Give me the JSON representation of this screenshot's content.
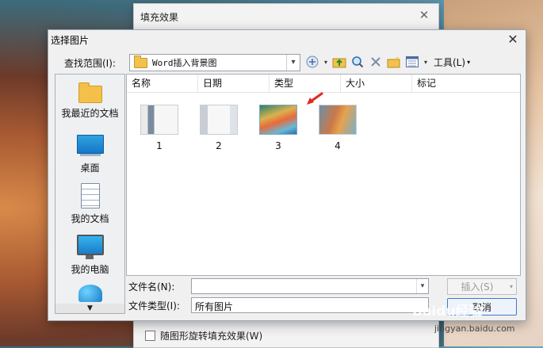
{
  "background_dialog": {
    "title": "填充效果",
    "close_glyph": "✕",
    "checkbox_label": "随图形旋转填充效果(W)"
  },
  "dialog": {
    "title": "选择图片",
    "close_glyph": "✕",
    "lookin_label": "查找范围(I):",
    "lookin_value": "Word插入背景图",
    "tools_label": "工具(L)",
    "sidebar": [
      {
        "label": "我最近的文档",
        "icon": "recent-folder-icon"
      },
      {
        "label": "桌面",
        "icon": "desktop-icon"
      },
      {
        "label": "我的文档",
        "icon": "documents-icon"
      },
      {
        "label": "我的电脑",
        "icon": "computer-icon"
      },
      {
        "label": "",
        "icon": "network-icon"
      }
    ],
    "columns": [
      "名称",
      "日期",
      "类型",
      "大小",
      "标记"
    ],
    "files": [
      {
        "name": "1"
      },
      {
        "name": "2"
      },
      {
        "name": "3"
      },
      {
        "name": "4"
      }
    ],
    "filename_label": "文件名(N):",
    "filename_value": "",
    "filetype_label": "文件类型(I):",
    "filetype_value": "所有图片",
    "insert_button": "插入(S)",
    "cancel_button": "取消"
  },
  "watermark": "Baidu经验",
  "watermark_url": "jingyan.baidu.com",
  "colors": {
    "accent_arrow": "#e02a20",
    "focus_border": "#3b7bd6"
  }
}
